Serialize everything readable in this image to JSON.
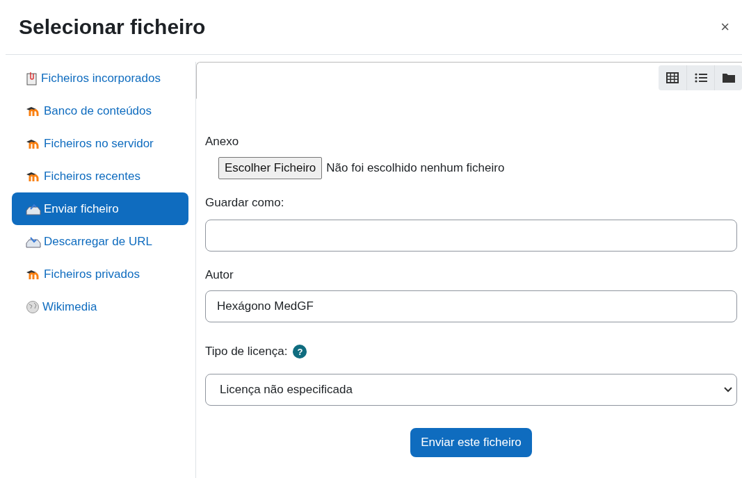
{
  "dialog": {
    "title": "Selecionar ficheiro",
    "close": "×"
  },
  "sidebar": {
    "items": [
      {
        "label": "Ficheiros incorporados",
        "kind": "file",
        "selected": false
      },
      {
        "label": "Banco de conteúdos",
        "kind": "moodle",
        "selected": false
      },
      {
        "label": "Ficheiros no servidor",
        "kind": "moodle",
        "selected": false
      },
      {
        "label": "Ficheiros recentes",
        "kind": "moodle",
        "selected": false
      },
      {
        "label": "Enviar ficheiro",
        "kind": "upload",
        "selected": true
      },
      {
        "label": "Descarregar de URL",
        "kind": "download",
        "selected": false
      },
      {
        "label": "Ficheiros privados",
        "kind": "moodle",
        "selected": false
      },
      {
        "label": "Wikimedia",
        "kind": "wiki",
        "selected": false
      }
    ]
  },
  "view_buttons": [
    {
      "kind": "grid"
    },
    {
      "kind": "list"
    },
    {
      "kind": "folder"
    }
  ],
  "form": {
    "attachment": {
      "label": "Anexo",
      "button": "Escolher Ficheiro",
      "status": "Não foi escolhido nenhum ficheiro"
    },
    "save_as": {
      "label": "Guardar como:"
    },
    "author": {
      "label": "Autor",
      "value": "Hexágono MedGF"
    },
    "license": {
      "label": "Tipo de licença:",
      "help": "?",
      "value": "Licença não especificada"
    },
    "submit": "Enviar este ficheiro"
  }
}
